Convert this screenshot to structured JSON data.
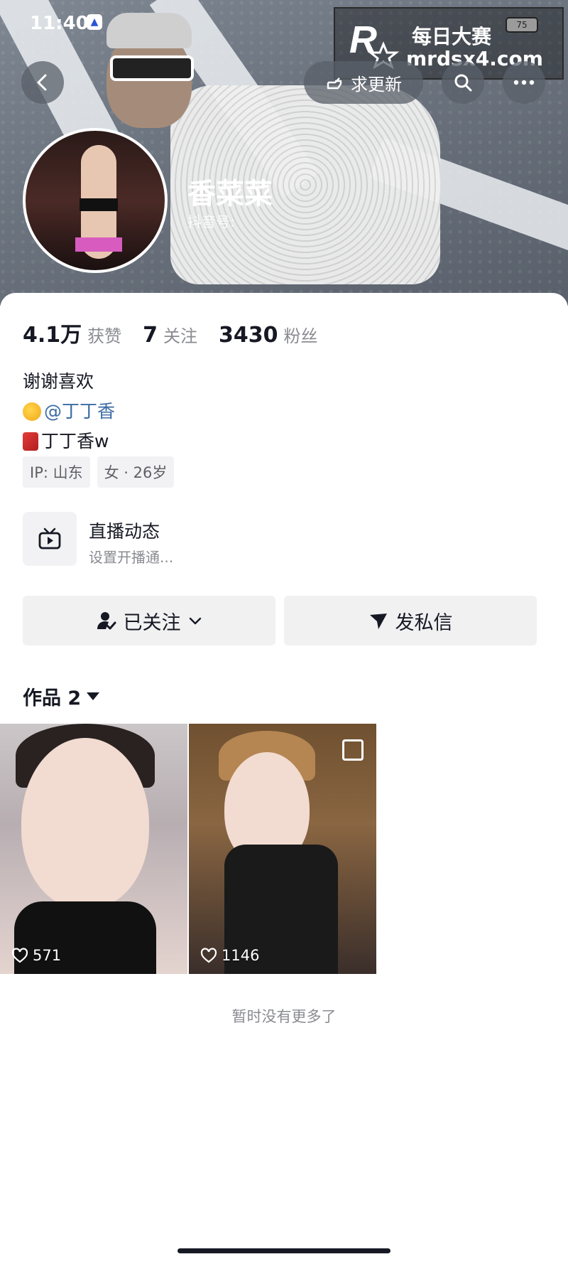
{
  "status_bar": {
    "time": "11:40",
    "battery": "75"
  },
  "watermark": {
    "title": "每日大赛",
    "url": "mrdsx4.com",
    "logo_small": "每日大赛"
  },
  "header": {
    "update_button": "求更新"
  },
  "profile": {
    "nickname": "香菜菜",
    "douyin_id_label": "抖音号:",
    "stats": [
      {
        "value": "4.1万",
        "label": "获赞"
      },
      {
        "value": "7",
        "label": "关注"
      },
      {
        "value": "3430",
        "label": "粉丝"
      }
    ],
    "bio": {
      "line1": "谢谢喜欢",
      "mention": "@丁丁香",
      "line3": "丁丁香w"
    },
    "tags": [
      "IP: 山东",
      "女 · 26岁"
    ]
  },
  "live": {
    "title": "直播动态",
    "subtitle": "设置开播通..."
  },
  "actions": {
    "follow": "已关注",
    "message": "发私信"
  },
  "works": {
    "tab_label": "作品 2",
    "videos": [
      {
        "likes": "571"
      },
      {
        "likes": "1146"
      }
    ],
    "end_text": "暂时没有更多了"
  },
  "icons": {
    "back": "chevron-left-icon",
    "update": "pointing-hand-icon",
    "search": "search-icon",
    "more": "more-dots-icon",
    "live": "tv-play-icon",
    "follow": "user-check-icon",
    "message": "send-icon",
    "like": "heart-outline-icon"
  }
}
